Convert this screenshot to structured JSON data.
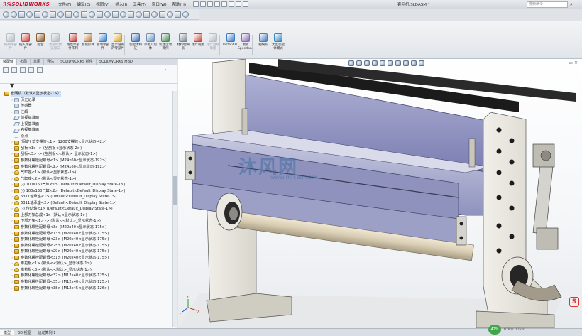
{
  "app": {
    "logo_ds": "3S",
    "logo_name": "SOLIDWORKS",
    "document_title": "套网机.SLDASM *",
    "search_placeholder": "搜索命令",
    "menus": [
      "文件(F)",
      "编辑(E)",
      "视图(V)",
      "插入(I)",
      "工具(T)",
      "窗口(W)",
      "帮助(H)"
    ]
  },
  "ribbon": {
    "buttons": [
      {
        "label": "编辑零部件",
        "icon": "edit-component-icon",
        "color": "#7a8694",
        "dim": true
      },
      {
        "label": "插入零部件",
        "icon": "insert-components-icon",
        "color": "#c8463c",
        "dim": false
      },
      {
        "label": "配合",
        "icon": "mate-icon",
        "color": "#8a5b2c",
        "dim": false
      },
      {
        "label": "零部件预览窗口",
        "icon": "component-preview-icon",
        "color": "#7a8694",
        "dim": true
      },
      {
        "label": "线性零部件阵列",
        "icon": "linear-pattern-icon",
        "color": "#c23b36",
        "dim": false
      },
      {
        "label": "智能扣件",
        "icon": "smart-fasteners-icon",
        "color": "#b5783a",
        "dim": false
      },
      {
        "label": "移动零部件",
        "icon": "move-component-icon",
        "color": "#3b7dc4",
        "dim": false
      },
      {
        "label": "显示隐藏的零部件",
        "icon": "show-hidden-icon",
        "color": "#d4a11d",
        "dim": false
      },
      {
        "label": "装配体特征",
        "icon": "assembly-features-icon",
        "color": "#3f73b3",
        "dim": false
      },
      {
        "label": "参考几何体",
        "icon": "reference-geometry-icon",
        "color": "#6d8fb8",
        "dim": false
      },
      {
        "label": "新建运动算例",
        "icon": "new-motion-study-icon",
        "color": "#4a8b5a",
        "dim": false
      },
      {
        "label": "材料明细表",
        "icon": "bom-icon",
        "color": "#7a8694",
        "dim": false
      },
      {
        "label": "爆炸视图",
        "icon": "exploded-view-icon",
        "color": "#c8463c",
        "dim": false
      },
      {
        "label": "爆炸直线草图",
        "icon": "explode-line-sketch-icon",
        "color": "#7a8694",
        "dim": true
      },
      {
        "label": "Instant3D",
        "icon": "instant3d-icon",
        "color": "#3b7dc4",
        "dim": false
      },
      {
        "label": "更新Speedpak",
        "icon": "speedpak-icon",
        "color": "#8a6cb4",
        "dim": false
      },
      {
        "label": "拍快照",
        "icon": "snapshot-icon",
        "color": "#4a7fbd",
        "dim": false
      },
      {
        "label": "大型装配体模式",
        "icon": "large-assembly-icon",
        "color": "#3a86c0",
        "dim": false
      }
    ]
  },
  "tabs": [
    "装配体",
    "布局",
    "草图",
    "评估",
    "SOLIDWORKS 插件",
    "SOLIDWORKS MBD"
  ],
  "tree": {
    "root": "套网机（默认<显示状态-1>）",
    "items": [
      {
        "label": "历史记录",
        "icon": "folder",
        "indent": 1,
        "exp": "›"
      },
      {
        "label": "传感器",
        "icon": "folder",
        "indent": 1,
        "exp": ""
      },
      {
        "label": "注解",
        "icon": "folder",
        "indent": 1,
        "exp": "›"
      },
      {
        "label": "前视基准面",
        "icon": "plane",
        "indent": 1,
        "exp": ""
      },
      {
        "label": "上视基准面",
        "icon": "plane",
        "indent": 1,
        "exp": ""
      },
      {
        "label": "右视基准面",
        "icon": "plane",
        "indent": 1,
        "exp": ""
      },
      {
        "label": "原点",
        "icon": "origin",
        "indent": 1,
        "exp": ""
      },
      {
        "label": "(固定) 剪支撑管<1> (1200支撑管<显示状态-42>)",
        "icon": "asm",
        "indent": 1,
        "exp": "›"
      },
      {
        "label": "刮板<1> -> (刮刮板<显示状态-2>)",
        "icon": "asm",
        "indent": 1,
        "exp": "›"
      },
      {
        "label": "刮板<3> -> (左刮板<<默认>_显示状态-1>)",
        "icon": "asm",
        "indent": 1,
        "exp": "›"
      },
      {
        "label": "参数化螺栓配螺母<1> (M24x60<显示状态-192>)",
        "icon": "asm",
        "indent": 1,
        "exp": "›"
      },
      {
        "label": "参数化螺栓配螺母<2> (M24x60<显示状态-192>)",
        "icon": "asm",
        "indent": 1,
        "exp": "›"
      },
      {
        "label": "气缸座<1> (默认<显示状态-1>)",
        "icon": "part",
        "indent": 1,
        "exp": "›"
      },
      {
        "label": "气缸座<2> (默认<显示状态-1>)",
        "icon": "part",
        "indent": 1,
        "exp": "›"
      },
      {
        "label": "(-) 100x150气缸<1> (Default<Default_Display State-1>)",
        "icon": "asm",
        "indent": 1,
        "exp": "›"
      },
      {
        "label": "(-) 100x150气缸<2> (Default<Default_Display State-1>)",
        "icon": "asm",
        "indent": 1,
        "exp": "›"
      },
      {
        "label": "6311轴承座<1> (Default<Default_Display State-1>)",
        "icon": "part",
        "indent": 1,
        "exp": "›"
      },
      {
        "label": "6311轴承座<2> (Default<Default_Display State-1>)",
        "icon": "part",
        "indent": 1,
        "exp": "›"
      },
      {
        "label": "(-) 传动轴<1> (Default<Default_Display State-1>)",
        "icon": "part",
        "indent": 1,
        "exp": "›"
      },
      {
        "label": "上部刀架总成<1> (默认<显示状态-1>)",
        "icon": "asm",
        "indent": 1,
        "exp": "›"
      },
      {
        "label": "下部刀架<1> -> (默认<<默认>_显示状态-1>)",
        "icon": "asm",
        "indent": 1,
        "exp": "›"
      },
      {
        "label": "参数化螺栓配螺母<3> (M20x40<显示状态-175>)",
        "icon": "asm",
        "indent": 1,
        "exp": "›"
      },
      {
        "label": "参数化螺栓配螺母<13> (M20x40<显示状态-175>)",
        "icon": "asm",
        "indent": 1,
        "exp": "›"
      },
      {
        "label": "参数化螺栓配螺母<23> (M20x40<显示状态-175>)",
        "icon": "asm",
        "indent": 1,
        "exp": "›"
      },
      {
        "label": "参数化螺栓配螺母<25> (M20x40<显示状态-175>)",
        "icon": "asm",
        "indent": 1,
        "exp": "›"
      },
      {
        "label": "参数化螺栓配螺母<29> (M20x40<显示状态-175>)",
        "icon": "asm",
        "indent": 1,
        "exp": "›"
      },
      {
        "label": "参数化螺栓配螺母<31> (M20x40<显示状态-175>)",
        "icon": "asm",
        "indent": 1,
        "exp": "›"
      },
      {
        "label": "推拉板<1> (默认<<默认>_显示状态-1>)",
        "icon": "part",
        "indent": 1,
        "exp": "›"
      },
      {
        "label": "推拉板<3> (默认<<默认>_显示状态-1>)",
        "icon": "part",
        "indent": 1,
        "exp": "›"
      },
      {
        "label": "参数化螺栓配螺母<32> (M12x40<显示状态-125>)",
        "icon": "asm",
        "indent": 1,
        "exp": "›"
      },
      {
        "label": "参数化螺栓配螺母<35> (M12x40<显示状态-125>)",
        "icon": "asm",
        "indent": 1,
        "exp": "›"
      },
      {
        "label": "参数化螺栓配螺母<38> (M12x45<显示状态-126>)",
        "icon": "asm",
        "indent": 1,
        "exp": "›"
      }
    ]
  },
  "viewport": {
    "watermark": "沐风网",
    "watermark_sub": "www.mfcad.com",
    "triad_x": "X",
    "triad_y": "Y",
    "triad_z": "Z"
  },
  "bottom_tabs": [
    "模型",
    "3D 视图",
    "运动算例 1"
  ],
  "status": {
    "badge": "42%",
    "speeds": "0.0k/s  0.1k/s"
  }
}
